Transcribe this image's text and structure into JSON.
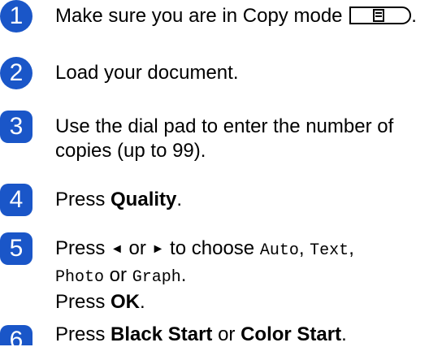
{
  "steps": [
    {
      "n": "1",
      "text": "Make sure you are in Copy mode"
    },
    {
      "n": "2",
      "text": "Load your document."
    },
    {
      "n": "3",
      "line1": "Use the dial pad to enter the number of",
      "line2": "copies (up to 99)."
    },
    {
      "n": "4",
      "pre": "Press ",
      "bold": "Quality",
      "post": "."
    },
    {
      "n": "5",
      "pre": "Press ",
      "left_arrow": "◄",
      "or1": " or ",
      "right_arrow": "►",
      "mid": " to choose ",
      "opt1": "Auto",
      "c1": ", ",
      "opt2": "Text",
      "c2": ",",
      "opt3": "Photo",
      "or2": " or ",
      "opt4": "Graph",
      "end": ".",
      "line3_pre": "Press ",
      "line3_bold": "OK",
      "line3_post": "."
    },
    {
      "n": "6",
      "pre": "Press ",
      "bold1": "Black Start",
      "mid": " or ",
      "bold2": "Color Start",
      "post": "."
    }
  ],
  "icons": {
    "copy_key": "copy-mode-key-icon"
  },
  "colors": {
    "step_badge": "#1a56c8"
  }
}
